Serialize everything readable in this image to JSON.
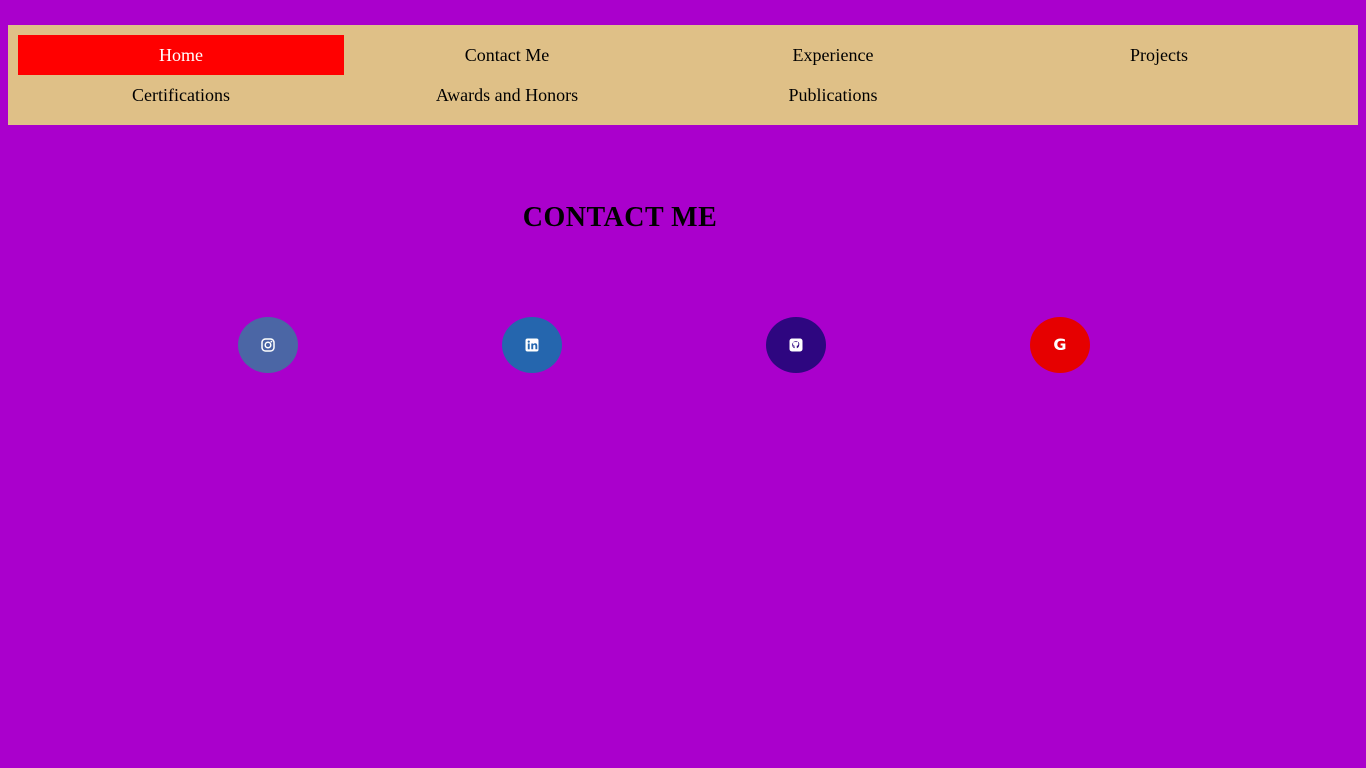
{
  "nav": {
    "items": [
      {
        "label": "Home",
        "active": true
      },
      {
        "label": "Contact Me"
      },
      {
        "label": "Experience"
      },
      {
        "label": "Projects"
      },
      {
        "label": "Certifications"
      },
      {
        "label": "Awards and Honors"
      },
      {
        "label": "Publications"
      }
    ]
  },
  "page": {
    "title": "CONTACT ME"
  },
  "social": {
    "items": [
      {
        "icon": "instagram-icon",
        "color": "#4b66a5"
      },
      {
        "icon": "linkedin-icon",
        "color": "#2566ae"
      },
      {
        "icon": "github-icon",
        "color": "#2e0680"
      },
      {
        "icon": "google-icon",
        "color": "#e60000",
        "glyph": "G"
      }
    ]
  },
  "colors": {
    "background": "#aa00cc",
    "navbar": "#dfc087",
    "active_nav": "#ff0000"
  }
}
